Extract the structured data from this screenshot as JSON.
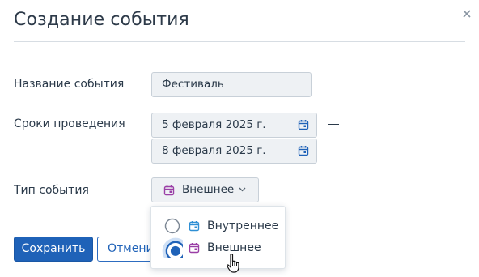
{
  "dialog": {
    "title": "Создание события",
    "close_icon": "close-icon",
    "fields": {
      "name_label": "Название события",
      "name_value": "Фестиваль",
      "dates_label": "Сроки проведения",
      "start_date": "5 февраля 2025 г.",
      "end_date": "8 февраля 2025 г.",
      "dash": "—",
      "type_label": "Тип события",
      "type_value": "Внешнее"
    },
    "type_dropdown": {
      "options": [
        {
          "label": "Внутреннее",
          "selected": false,
          "icon": "calendar-icon",
          "color": "#2f8fd4"
        },
        {
          "label": "Внешнее",
          "selected": true,
          "icon": "calendar-icon",
          "color": "#9a3fa6"
        }
      ]
    },
    "footer": {
      "save_label": "Сохранить",
      "cancel_label": "Отменить"
    }
  },
  "colors": {
    "primary": "#1f62b8",
    "field_bg": "#eef1f4",
    "field_border": "#c8d0d8",
    "internal_icon": "#2f8fd4",
    "external_icon": "#9a3fa6"
  }
}
